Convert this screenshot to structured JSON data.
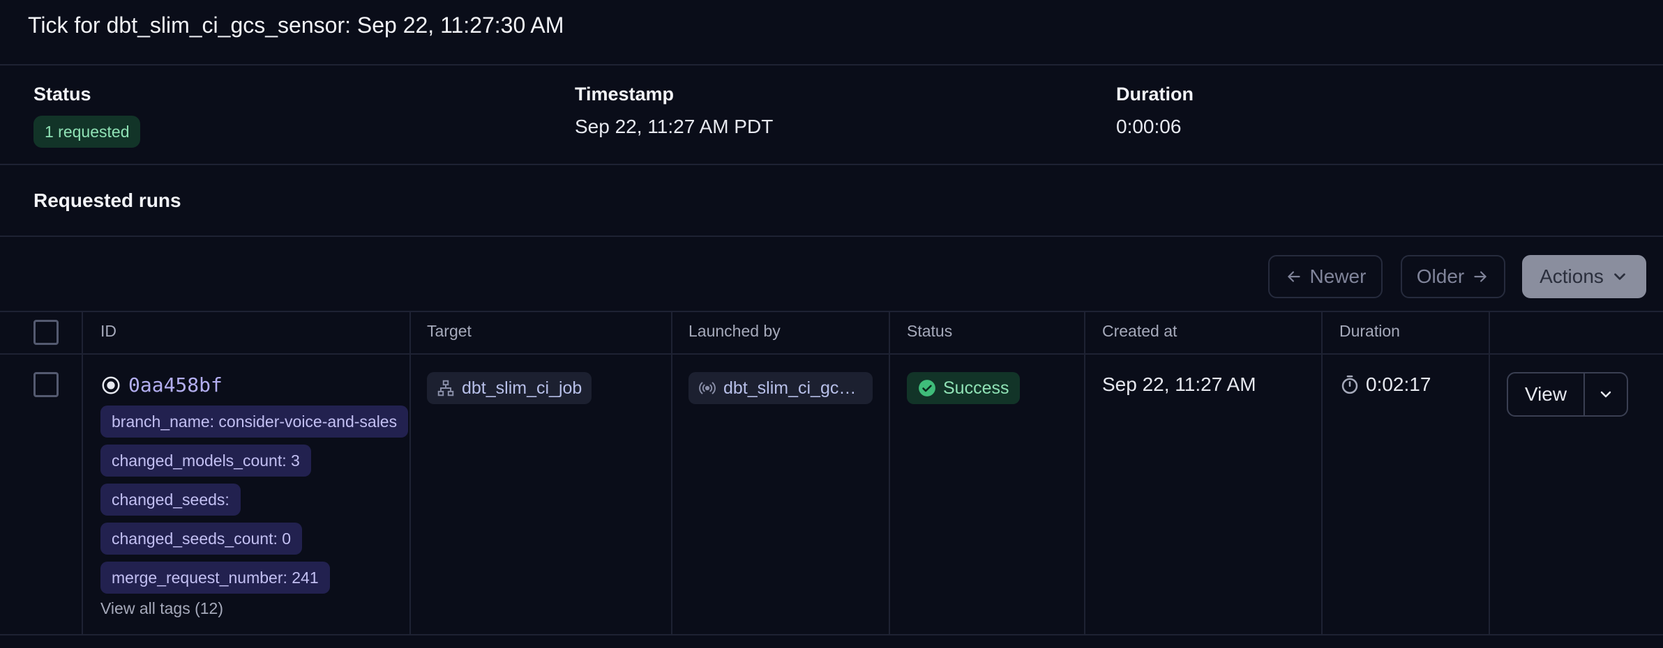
{
  "title": "Tick for dbt_slim_ci_gcs_sensor: Sep 22, 11:27:30 AM",
  "meta": {
    "status_label": "Status",
    "status_value": "1 requested",
    "timestamp_label": "Timestamp",
    "timestamp_value": "Sep 22, 11:27 AM PDT",
    "duration_label": "Duration",
    "duration_value": "0:00:06"
  },
  "section_title": "Requested runs",
  "pagination": {
    "newer": "Newer",
    "older": "Older",
    "actions": "Actions"
  },
  "table": {
    "headers": {
      "id": "ID",
      "target": "Target",
      "launched_by": "Launched by",
      "status": "Status",
      "created_at": "Created at",
      "duration": "Duration"
    },
    "row": {
      "id": "0aa458bf",
      "tags": [
        "branch_name: consider-voice-and-sales",
        "changed_models_count: 3",
        "changed_seeds:",
        "changed_seeds_count: 0",
        "merge_request_number: 241"
      ],
      "view_all_tags": "View all tags (12)",
      "target": "dbt_slim_ci_job",
      "launched_by": "dbt_slim_ci_gcs_sensor",
      "status": "Success",
      "created_at": "Sep 22, 11:27 AM",
      "duration": "0:02:17",
      "view_label": "View"
    }
  },
  "colors": {
    "background": "#0a0d19",
    "success_bg": "#123428",
    "success_fg": "#8fe2b5",
    "tag_bg": "#22214f",
    "tag_fg": "#c2bff2"
  }
}
